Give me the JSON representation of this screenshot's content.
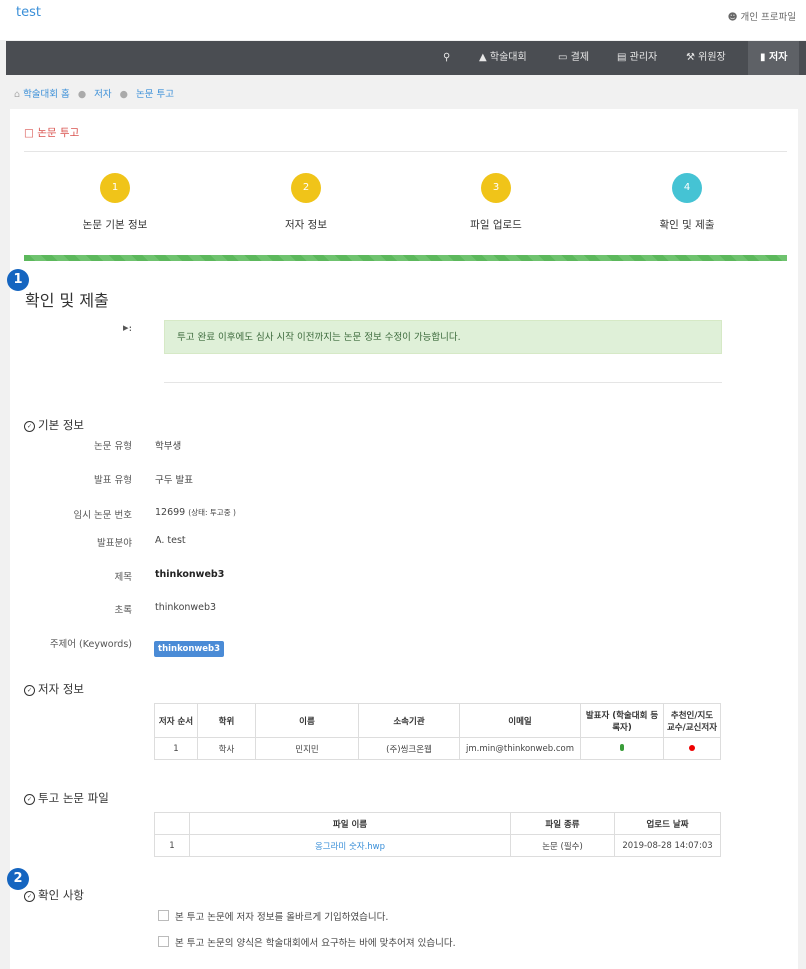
{
  "app": {
    "brand": "test",
    "profile": "개인 프로파일"
  },
  "nav": {
    "search_icon": "search-icon",
    "items": [
      {
        "label": "학술대회",
        "icon": "graduation-cap-icon"
      },
      {
        "label": "결제",
        "icon": "credit-card-icon"
      },
      {
        "label": "관리자",
        "icon": "server-icon"
      },
      {
        "label": "위원장",
        "icon": "gavel-icon"
      },
      {
        "label": "저자",
        "icon": "book-icon"
      }
    ]
  },
  "breadcrumb": [
    "학술대회 홈",
    "저자",
    "논문 투고"
  ],
  "page": {
    "title": "논문 투고",
    "heading": "확인 및 제출"
  },
  "steps": [
    {
      "num": "1",
      "label": "논문 기본 정보",
      "color": "#f0c419"
    },
    {
      "num": "2",
      "label": "저자 정보",
      "color": "#f0c419"
    },
    {
      "num": "3",
      "label": "파일 업로드",
      "color": "#f0c419"
    },
    {
      "num": "4",
      "label": "확인 및 제출",
      "color": "#45c3d4"
    }
  ],
  "progress": {
    "percent": 100,
    "color": "#5cb85c"
  },
  "badges": [
    "1",
    "2"
  ],
  "notice": "투고 완료 이후에도 심사 시작 이전까지는 논문 정보 수정이 가능합니다.",
  "basic": {
    "title": "기본 정보",
    "rows": [
      {
        "label": "논문 유형",
        "value": "학부생"
      },
      {
        "label": "발표 유형",
        "value": "구두 발표"
      },
      {
        "label": "임시 논문 번호",
        "value": "12699",
        "note": "(상태: 투고중 )"
      },
      {
        "label": "발표분야",
        "value": "A. test"
      },
      {
        "label": "제목",
        "value": "thinkonweb3"
      },
      {
        "label": "초록",
        "value": "thinkonweb3"
      },
      {
        "label": "주제어 (Keywords)",
        "value": "thinkonweb3"
      }
    ]
  },
  "authors": {
    "title": "저자 정보",
    "headers": [
      "저자 순서",
      "학위",
      "이름",
      "소속기관",
      "이메일",
      "발표자 (학술대회 등록자)",
      "추천인/지도 교수/교신저자"
    ],
    "rows": [
      {
        "order": "1",
        "degree": "학사",
        "name": "민지민",
        "org": "(주)씽크온웹",
        "email": "jm.min@thinkonweb.com"
      }
    ]
  },
  "files": {
    "title": "투고 논문 파일",
    "headers": [
      "",
      "파일 이름",
      "파일 종류",
      "업로드 날짜"
    ],
    "rows": [
      {
        "num": "1",
        "name": "옹그라미 숫자.hwp",
        "type": "논문 (필수)",
        "date": "2019-08-28 14:07:03"
      }
    ]
  },
  "confirm": {
    "title": "확인 사항",
    "items": [
      "본 투고 논문에 저자 정보를 올바르게 기입하였습니다.",
      "본 투고 논문의 양식은 학술대회에서 요구하는 바에 맞추어져 있습니다."
    ]
  }
}
